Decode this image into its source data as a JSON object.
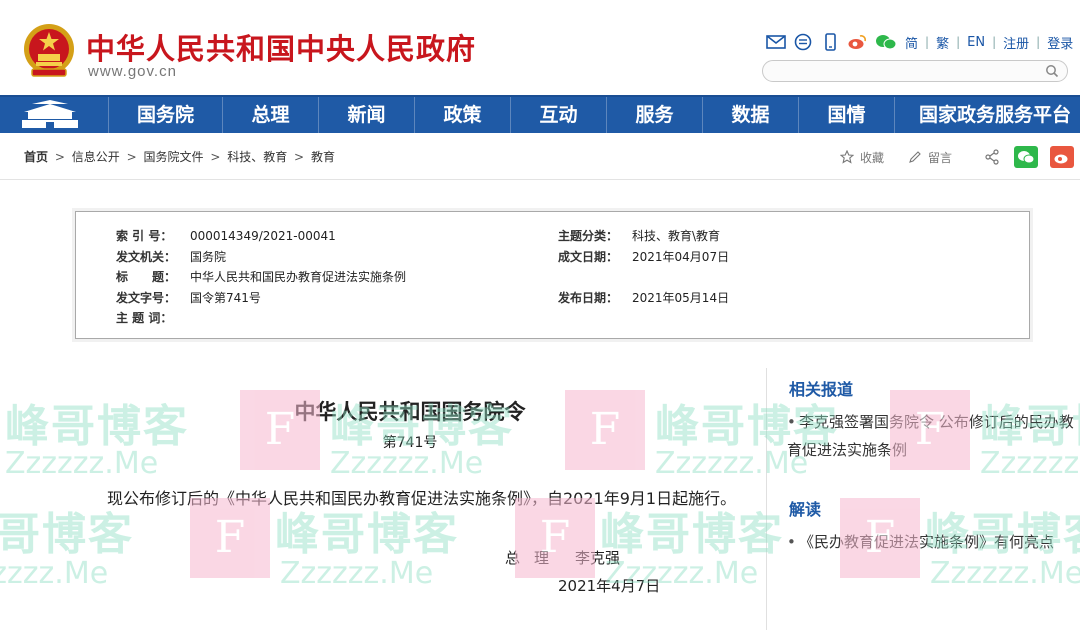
{
  "header": {
    "site_title": "中华人民共和国中央人民政府",
    "site_url": "www.gov.cn",
    "lang_links": [
      "简",
      "繁",
      "EN",
      "注册",
      "登录"
    ],
    "search_placeholder": ""
  },
  "nav": {
    "items": [
      "国务院",
      "总理",
      "新闻",
      "政策",
      "互动",
      "服务",
      "数据",
      "国情",
      "国家政务服务平台"
    ]
  },
  "breadcrumb": {
    "home": "首页",
    "items": [
      "信息公开",
      "国务院文件",
      "科技、教育",
      "教育"
    ],
    "separator": ">"
  },
  "actions": {
    "favorite": "收藏",
    "comment": "留言"
  },
  "info": {
    "index_no_label": "索 引 号：",
    "index_no": "000014349/2021-00041",
    "issuer_label": "发文机关：",
    "issuer": "国务院",
    "title_label": "标　　题：",
    "title": "中华人民共和国民办教育促进法实施条例",
    "doc_no_label": "发文字号：",
    "doc_no": "国令第741号",
    "keywords_label": "主 题 词：",
    "keywords": "",
    "category_label": "主题分类：",
    "category": "科技、教育\\教育",
    "created_label": "成文日期：",
    "created": "2021年04月07日",
    "published_label": "发布日期：",
    "published": "2021年05月14日"
  },
  "document": {
    "title": "中华人民共和国国务院令",
    "number": "第741号",
    "body": "现公布修订后的《中华人民共和国民办教育促进法实施条例》，自2021年9月1日起施行。",
    "sign_title": "总理",
    "sign_name": "李克强",
    "date": "2021年4月7日"
  },
  "sidebar": {
    "related_heading": "相关报道",
    "related_items": [
      "李克强签署国务院令 公布修订后的民办教育促进法实施条例"
    ],
    "interpret_heading": "解读",
    "interpret_items": [
      "《民办教育促进法实施条例》有何亮点"
    ]
  },
  "watermark": {
    "text_cn": "峰哥博客",
    "text_en": "Zzzzzz.Me",
    "letter": "F"
  },
  "colors": {
    "brand_red": "#c8161d",
    "nav_blue": "#1f5aa6",
    "wechat_green": "#2eb84b",
    "weibo_red": "#e9573f",
    "watermark_green": "#8fe0c4",
    "watermark_pink": "#f6b8cf"
  }
}
